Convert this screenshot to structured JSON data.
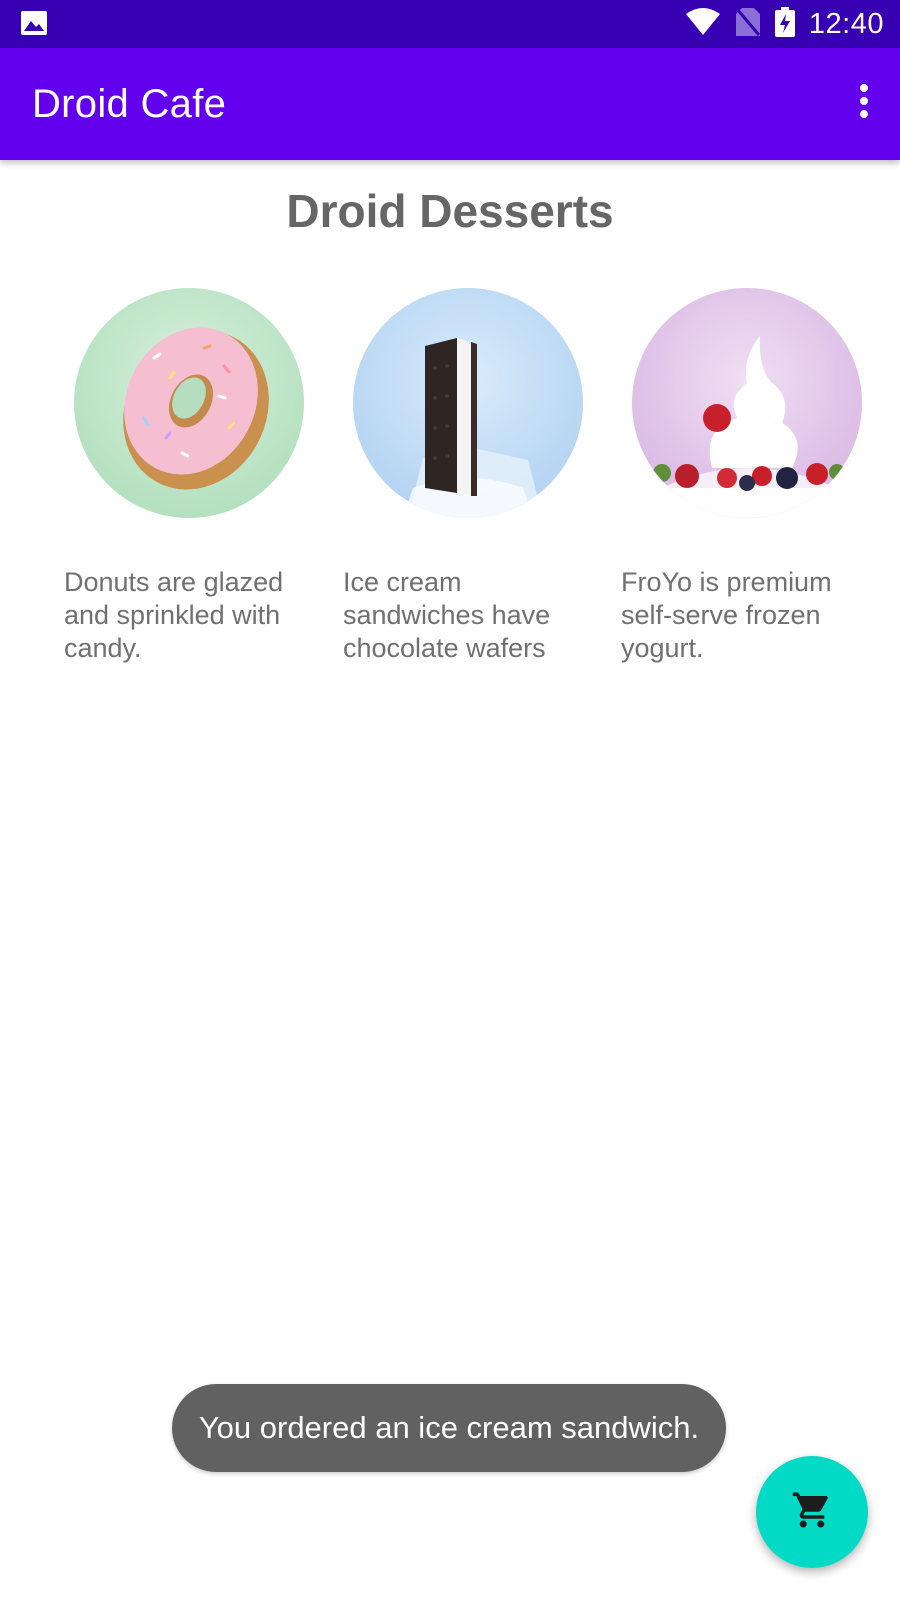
{
  "status_bar": {
    "time": "12:40",
    "icons": [
      "image-icon",
      "wifi-icon",
      "no-sim-icon",
      "battery-charging-icon"
    ]
  },
  "app_bar": {
    "title": "Droid Cafe",
    "menu_icon": "more-vert-icon"
  },
  "content": {
    "heading": "Droid Desserts",
    "desserts": [
      {
        "name": "donut",
        "description": "Donuts are glazed and sprinkled with candy."
      },
      {
        "name": "ice-cream-sandwich",
        "description": "Ice cream sandwiches have chocolate wafers"
      },
      {
        "name": "froyo",
        "description": "FroYo is premium self-serve frozen yogurt."
      }
    ]
  },
  "toast": {
    "message": "You ordered an ice cream sandwich."
  },
  "fab": {
    "icon": "shopping-cart-icon"
  },
  "colors": {
    "status_bar": "#3700b3",
    "app_bar": "#6200ee",
    "fab": "#03dac5",
    "toast": "#616161",
    "text_gray": "#707070"
  }
}
